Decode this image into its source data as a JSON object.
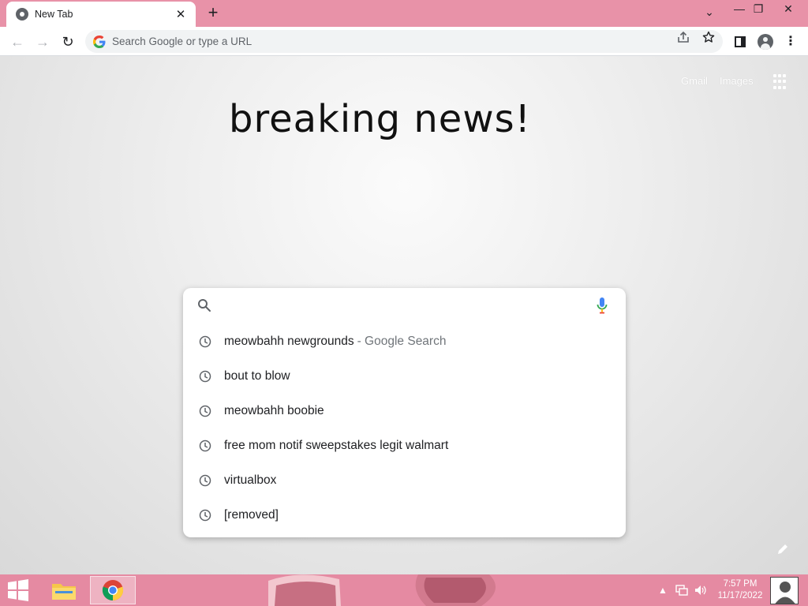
{
  "tab": {
    "title": "New Tab",
    "close_glyph": "✕"
  },
  "new_tab": {
    "glyph": "+"
  },
  "window_controls": {
    "tab_search_glyph": "⌄",
    "minimize_glyph": "—",
    "restore_glyph": "❐",
    "close_glyph": "✕"
  },
  "toolbar": {
    "back_glyph": "←",
    "forward_glyph": "→",
    "reload_glyph": "↻",
    "omnibox_placeholder": "Search Google or type a URL",
    "kebab_glyph": "⋮"
  },
  "ntp": {
    "gmail_label": "Gmail",
    "images_label": "Images",
    "doodle_text": "breaking news!",
    "search_value": "",
    "suggestions": [
      {
        "text": "meowbahh newgrounds",
        "suffix": "- Google Search"
      },
      {
        "text": "bout to blow",
        "suffix": ""
      },
      {
        "text": "meowbahh boobie",
        "suffix": ""
      },
      {
        "text": "free mom notif sweepstakes legit walmart",
        "suffix": ""
      },
      {
        "text": "virtualbox",
        "suffix": ""
      },
      {
        "text": "[removed]",
        "suffix": ""
      }
    ]
  },
  "taskbar": {
    "tray_up_glyph": "▲",
    "time": "7:57 PM",
    "date": "11/17/2022"
  },
  "colors": {
    "tabstrip": "#e892a8",
    "taskbar": "#e58aa2",
    "google_blue": "#4285f4"
  },
  "icons": [
    "chrome-icon",
    "google-g-icon",
    "share-icon",
    "star-icon",
    "side-panel-icon",
    "profile-icon",
    "apps-grid-icon",
    "search-icon",
    "mic-icon",
    "clock-history-icon",
    "pencil-icon",
    "windows-logo-icon",
    "file-explorer-icon",
    "network-icon",
    "volume-icon",
    "user-tile-icon"
  ]
}
